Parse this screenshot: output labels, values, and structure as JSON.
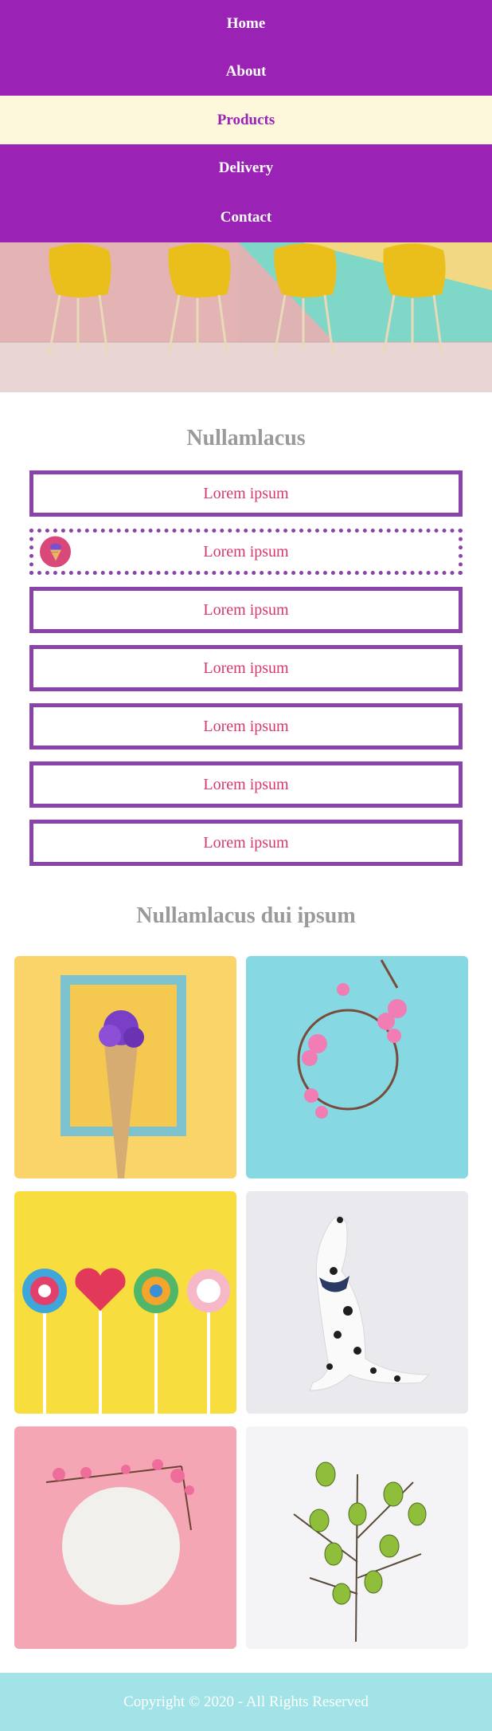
{
  "nav": {
    "items": [
      {
        "label": "Home",
        "active": false
      },
      {
        "label": "About",
        "active": false
      },
      {
        "label": "Products",
        "active": true
      },
      {
        "label": "Delivery",
        "active": false
      },
      {
        "label": "Contact",
        "active": false
      }
    ]
  },
  "hero": {
    "image": "yellow-chairs-image"
  },
  "section1": {
    "title": "Nullamlacus",
    "items": [
      {
        "label": "Lorem ipsum"
      },
      {
        "label": "Lorem ipsum",
        "hover": true,
        "icon": "ice-cream-icon"
      },
      {
        "label": "Lorem ipsum"
      },
      {
        "label": "Lorem ipsum"
      },
      {
        "label": "Lorem ipsum"
      },
      {
        "label": "Lorem ipsum"
      },
      {
        "label": "Lorem ipsum"
      }
    ]
  },
  "section2": {
    "title": "Nullamlacus dui ipsum",
    "tiles": [
      {
        "image": "ice-cream-frame-image"
      },
      {
        "image": "flower-wreath-image"
      },
      {
        "image": "lollipops-image"
      },
      {
        "image": "dalmatian-image"
      },
      {
        "image": "plate-blossom-image"
      },
      {
        "image": "easter-eggs-branch-image"
      }
    ]
  },
  "colors": {
    "nav_bg": "#9a23b5",
    "nav_active_bg": "#fdf8dc",
    "list_border": "#8a44a9",
    "list_text": "#d43a6b",
    "title_text": "#9a9a9a",
    "footer_bg": "#a2e3e8"
  },
  "footer": {
    "text": "Copyright © 2020 - All Rights Reserved"
  }
}
